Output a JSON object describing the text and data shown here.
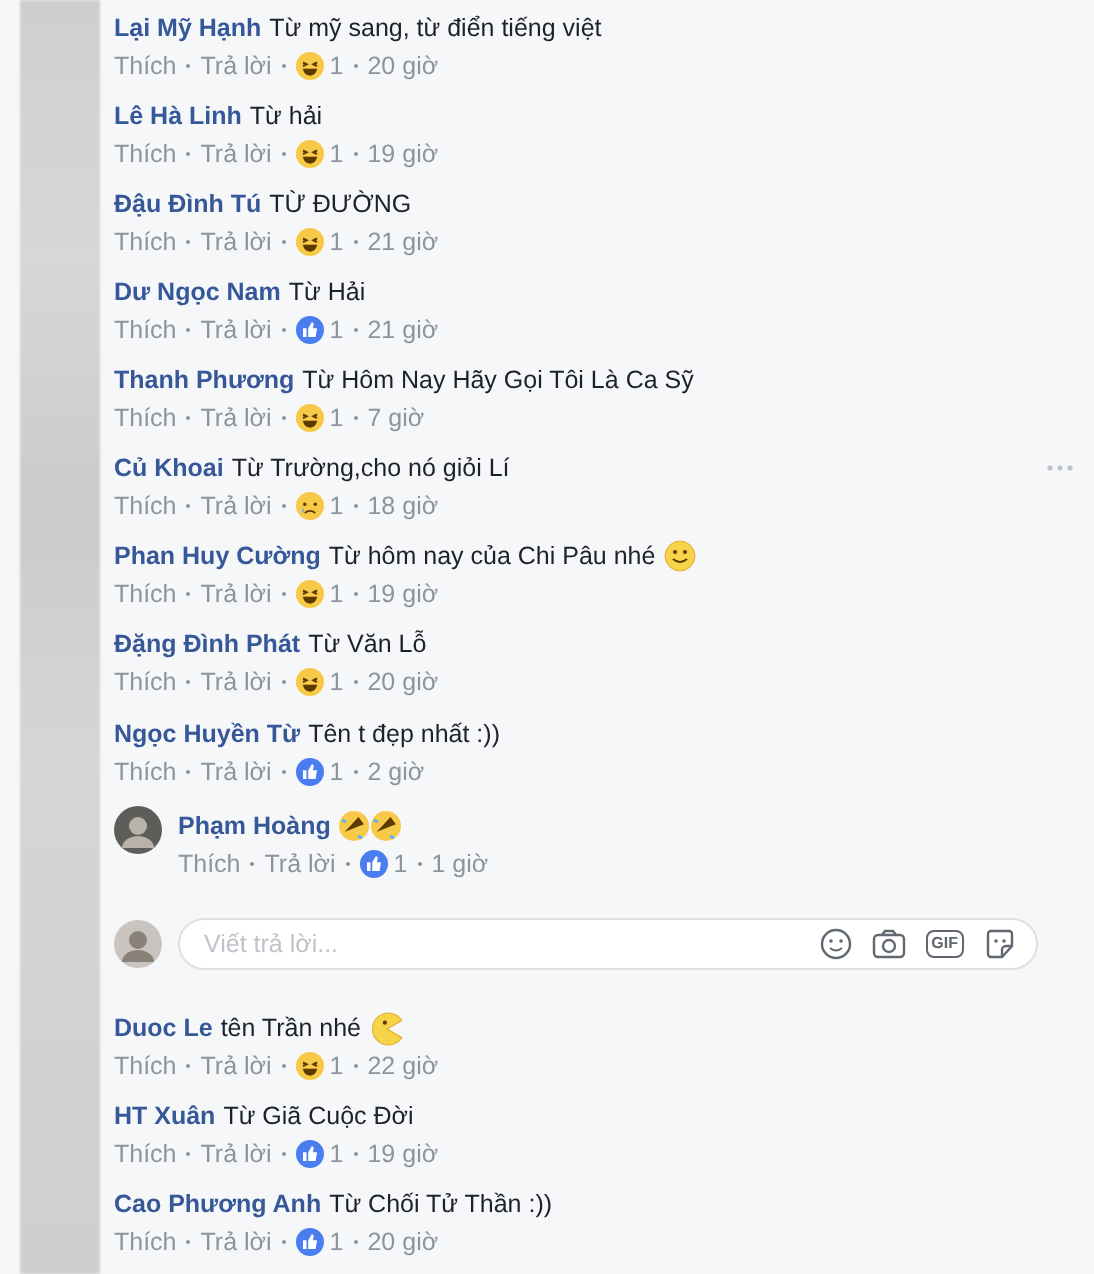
{
  "comments": [
    {
      "name": "Lại Mỹ Hạnh",
      "text": "Từ mỹ sang, từ điển tiếng việt",
      "like": "Thích",
      "reply": "Trả lời",
      "reaction": {
        "kind": "haha",
        "count": "1"
      },
      "time": "20 giờ"
    },
    {
      "name": "Lê Hà Linh",
      "text": "Từ hải",
      "like": "Thích",
      "reply": "Trả lời",
      "reaction": {
        "kind": "haha",
        "count": "1"
      },
      "time": "19 giờ"
    },
    {
      "name": "Đậu Đình Tú",
      "text": "TỪ ĐƯỜNG",
      "like": "Thích",
      "reply": "Trả lời",
      "reaction": {
        "kind": "haha",
        "count": "1"
      },
      "time": "21 giờ"
    },
    {
      "name": "Dư Ngọc Nam",
      "text": "Từ Hải",
      "like": "Thích",
      "reply": "Trả lời",
      "reaction": {
        "kind": "like",
        "count": "1"
      },
      "time": "21 giờ"
    },
    {
      "name": "Thanh Phương",
      "text": "Từ Hôm Nay Hãy Gọi Tôi Là Ca Sỹ",
      "like": "Thích",
      "reply": "Trả lời",
      "reaction": {
        "kind": "haha",
        "count": "1"
      },
      "time": "7 giờ"
    },
    {
      "name": "Củ Khoai",
      "text": "Từ Trường,cho nó giỏi Lí",
      "like": "Thích",
      "reply": "Trả lời",
      "reaction": {
        "kind": "sad",
        "count": "1"
      },
      "time": "18 giờ",
      "menu": true
    },
    {
      "name": "Phan Huy Cường",
      "text": "Từ hôm nay của Chi Pâu nhé",
      "emojis": [
        {
          "kind": "smile"
        }
      ],
      "like": "Thích",
      "reply": "Trả lời",
      "reaction": {
        "kind": "haha",
        "count": "1"
      },
      "time": "19 giờ"
    },
    {
      "name": "Đặng Đình Phát",
      "text": "Từ Văn Lỗ",
      "like": "Thích",
      "reply": "Trả lời",
      "reaction": {
        "kind": "haha",
        "count": "1"
      },
      "time": "20 giờ"
    },
    {
      "name": "Ngọc Huyền Từ",
      "text": "Tên t đẹp nhất :))",
      "like": "Thích",
      "reply": "Trả lời",
      "reaction": {
        "kind": "like",
        "count": "1"
      },
      "time": "2 giờ",
      "replies": [
        {
          "name": "Phạm Hoàng",
          "emojis": [
            {
              "kind": "rofl"
            },
            {
              "kind": "rofl"
            }
          ],
          "like": "Thích",
          "reply": "Trả lời",
          "reaction": {
            "kind": "like",
            "count": "1"
          },
          "time": "1 giờ"
        }
      ],
      "reply_box": {
        "placeholder": "Viết trả lời...",
        "gif_label": "GIF"
      }
    },
    {
      "name": "Duoc Le",
      "text": "tên Trần nhé",
      "emojis": [
        {
          "kind": "pacman"
        }
      ],
      "like": "Thích",
      "reply": "Trả lời",
      "reaction": {
        "kind": "haha",
        "count": "1"
      },
      "time": "22 giờ"
    },
    {
      "name": "HT Xuân",
      "text": "Từ Giã Cuộc Đời",
      "like": "Thích",
      "reply": "Trả lời",
      "reaction": {
        "kind": "like",
        "count": "1"
      },
      "time": "19 giờ"
    },
    {
      "name": "Cao Phương Anh",
      "text": "Từ Chối Tử Thần :))",
      "like": "Thích",
      "reply": "Trả lời",
      "reaction": {
        "kind": "like",
        "count": "1"
      },
      "time": "20 giờ"
    }
  ]
}
